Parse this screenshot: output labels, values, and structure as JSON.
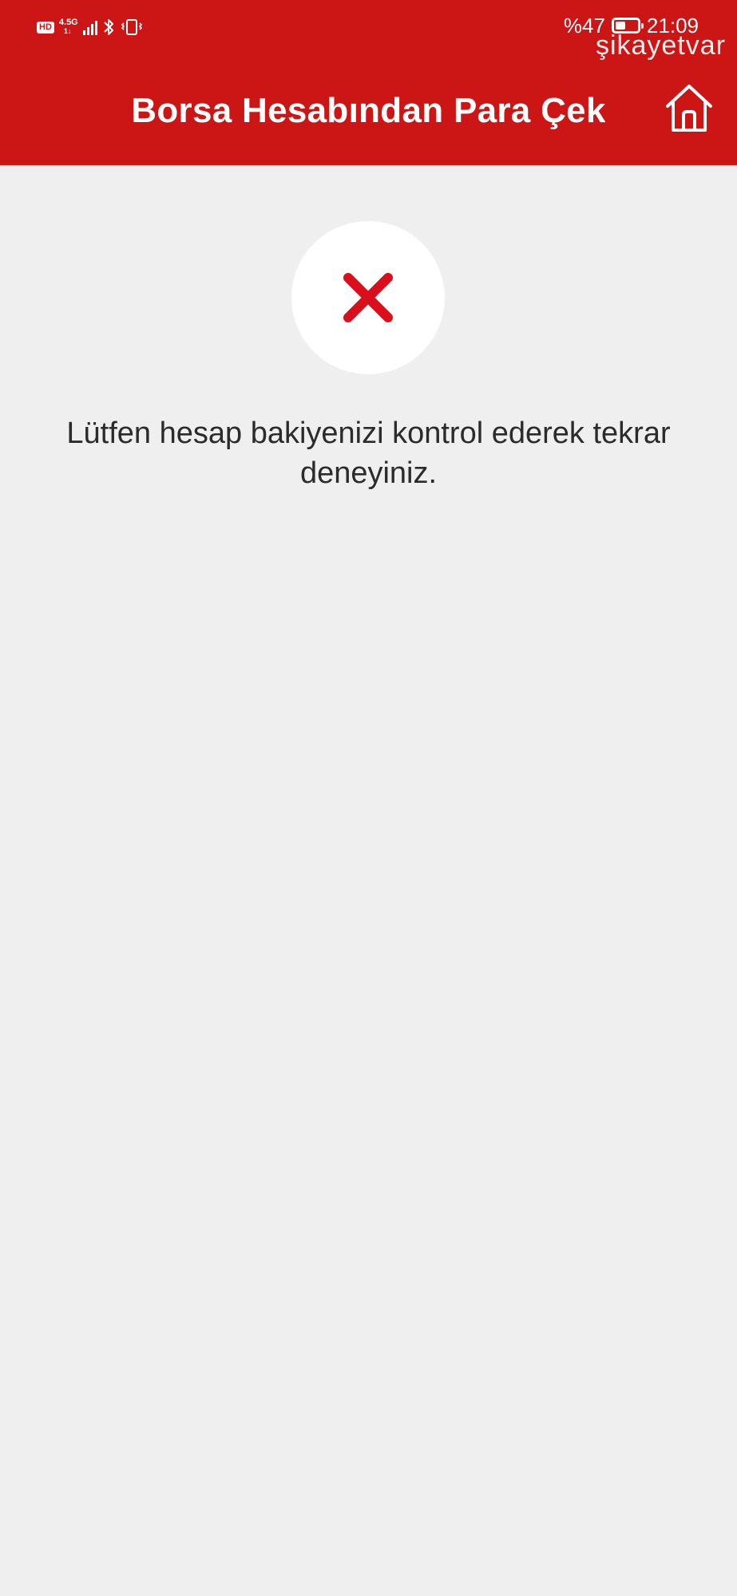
{
  "status_bar": {
    "hd_badge": "HD",
    "network_type": "4.5G",
    "network_sub": "1↓",
    "battery_percent": "%47",
    "battery_level": 0.47,
    "time": "21:09"
  },
  "watermark": "şikayetvar",
  "header": {
    "title": "Borsa Hesabından Para Çek",
    "home_icon": "home-icon"
  },
  "result": {
    "status_icon": "close-icon",
    "icon_color": "#d9101b",
    "message": "Lütfen hesap bakiyenizi kontrol ederek tekrar deneyiniz."
  },
  "colors": {
    "brand_red": "#cc1515",
    "background": "#efefef"
  }
}
